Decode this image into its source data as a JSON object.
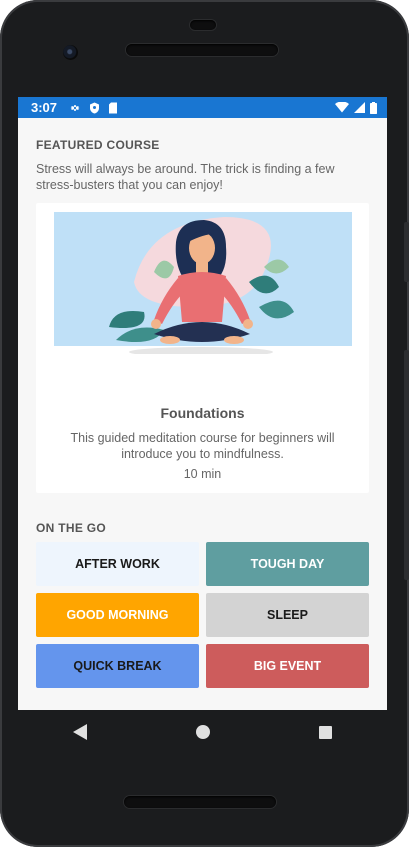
{
  "status_bar": {
    "time": "3:07",
    "bg_color": "#1976d2",
    "left_icons": [
      "gear-icon",
      "shield-icon",
      "sd-card-icon"
    ],
    "right_icons": [
      "wifi-icon",
      "signal-icon",
      "battery-icon"
    ]
  },
  "featured": {
    "section_title": "FEATURED COURSE",
    "subtitle": "Stress will always be around. The trick is finding a few stress-busters that you can enjoy!",
    "card": {
      "image": "meditation-illustration",
      "title": "Foundations",
      "description": "This guided meditation course for beginners will introduce you to mindfulness.",
      "duration": "10 min"
    }
  },
  "on_the_go": {
    "section_title": "ON THE GO",
    "tiles": [
      {
        "label": "AFTER WORK",
        "bg": "#eef5fd",
        "color": "#1a1a1a"
      },
      {
        "label": "TOUGH DAY",
        "bg": "#5f9ea0",
        "color": "#ffffff"
      },
      {
        "label": "GOOD MORNING",
        "bg": "#ffa500",
        "color": "#ffffff"
      },
      {
        "label": "SLEEP",
        "bg": "#d3d3d3",
        "color": "#1a1a1a"
      },
      {
        "label": "QUICK BREAK",
        "bg": "#6495ed",
        "color": "#1a1a1a"
      },
      {
        "label": "BIG EVENT",
        "bg": "#cd5c5c",
        "color": "#ffffff"
      }
    ]
  },
  "nav_bar": {
    "buttons": [
      "back-icon",
      "home-icon",
      "recents-icon"
    ]
  }
}
